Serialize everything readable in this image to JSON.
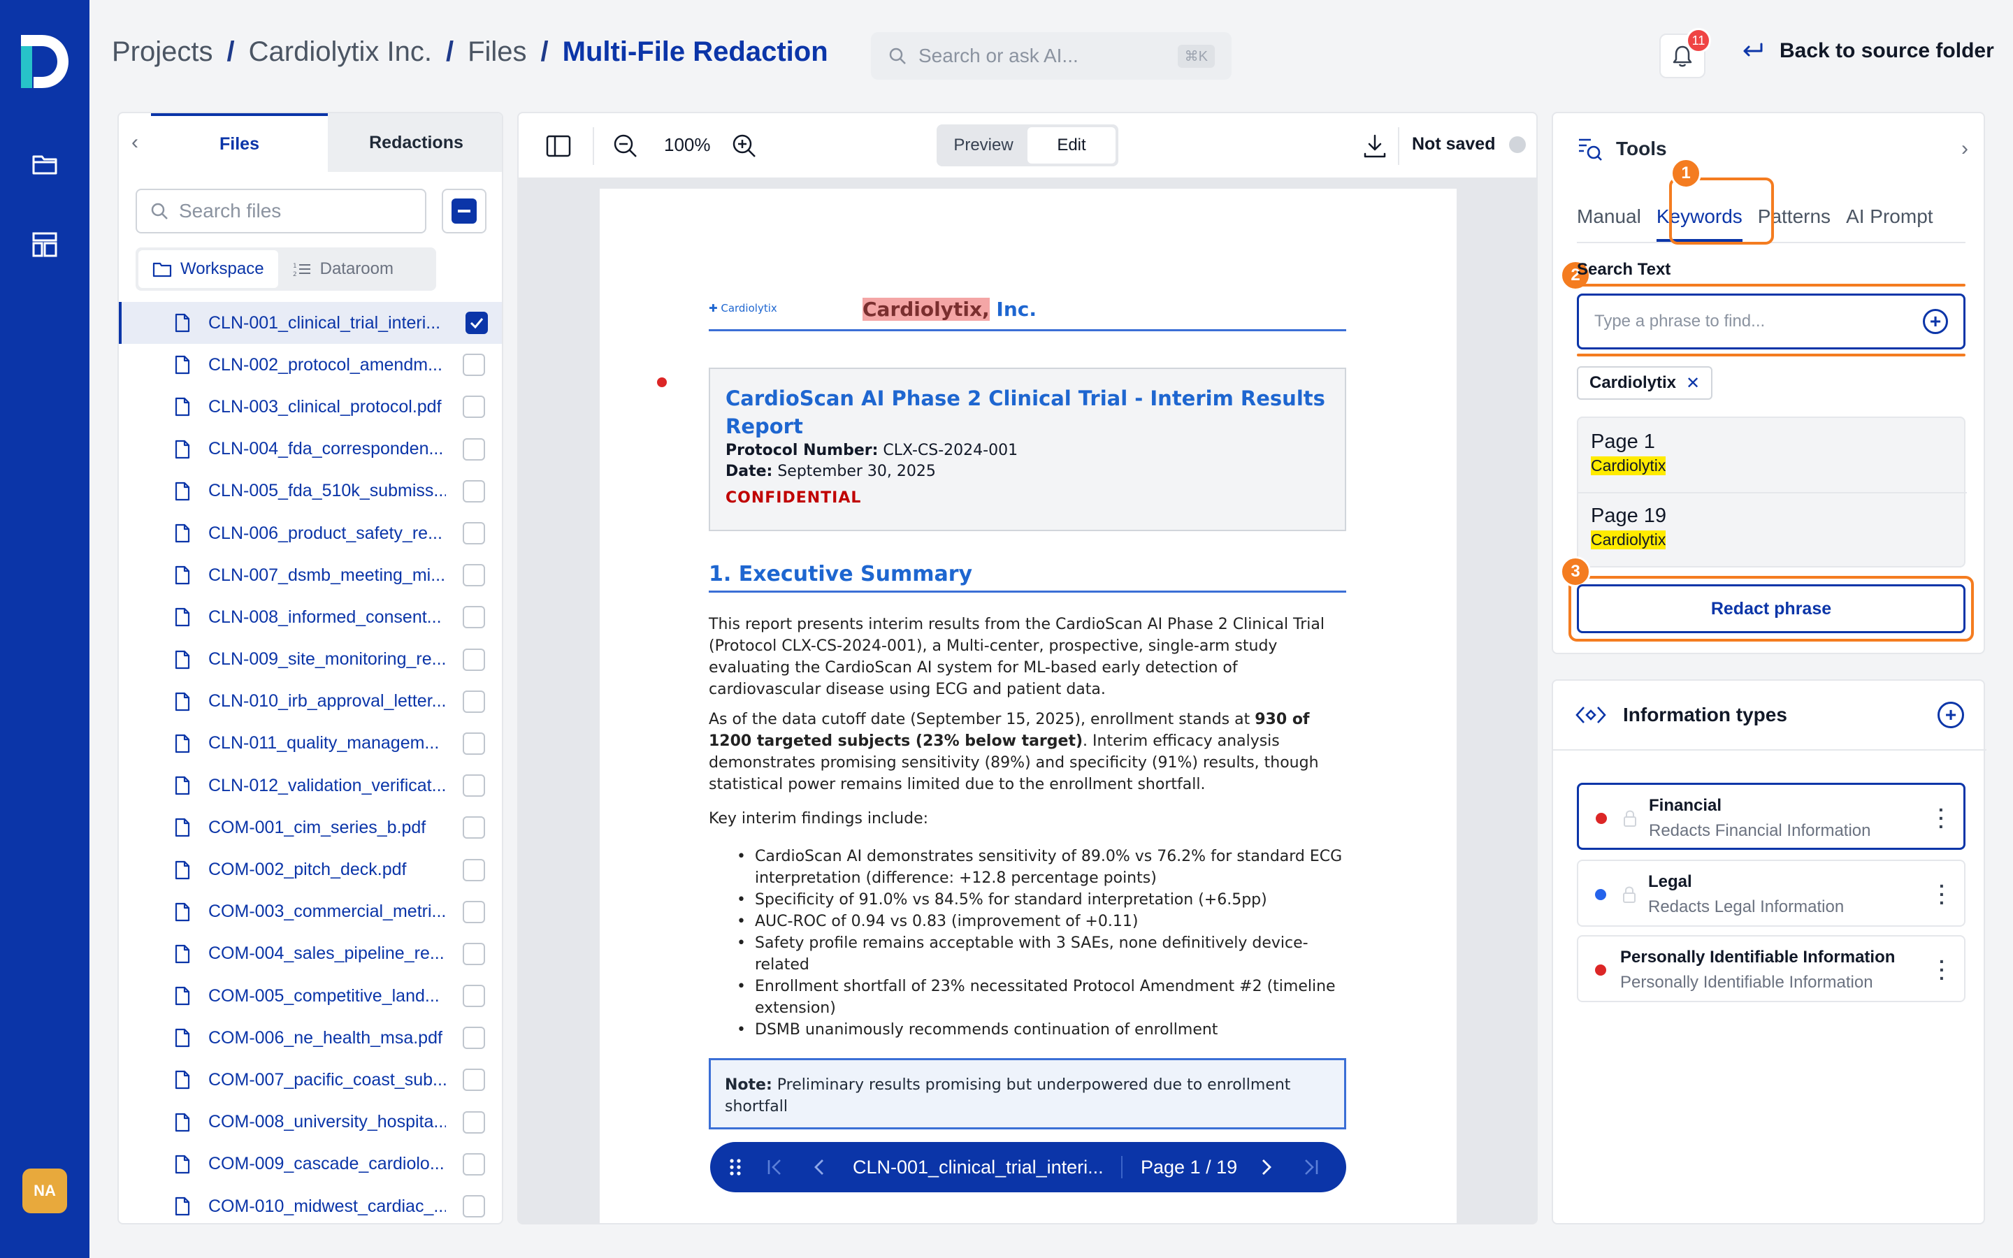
{
  "rail": {
    "avatar": "NA"
  },
  "breadcrumb": {
    "items": [
      "Projects",
      "Cardiolytix Inc.",
      "Files",
      "Multi-File Redaction"
    ],
    "sep": "/"
  },
  "search": {
    "placeholder": "Search or ask AI...",
    "shortcut": "⌘K"
  },
  "notifications": {
    "count": "11"
  },
  "back": {
    "label": "Back to source folder"
  },
  "files_panel": {
    "tabs": [
      "Files",
      "Redactions"
    ],
    "search_placeholder": "Search files",
    "segments": [
      "Workspace",
      "Dataroom"
    ],
    "files": [
      {
        "name": "CLN-001_clinical_trial_interi...",
        "checked": true
      },
      {
        "name": "CLN-002_protocol_amendm...",
        "checked": false
      },
      {
        "name": "CLN-003_clinical_protocol.pdf",
        "checked": false
      },
      {
        "name": "CLN-004_fda_corresponden...",
        "checked": false
      },
      {
        "name": "CLN-005_fda_510k_submiss...",
        "checked": false
      },
      {
        "name": "CLN-006_product_safety_re...",
        "checked": false
      },
      {
        "name": "CLN-007_dsmb_meeting_mi...",
        "checked": false
      },
      {
        "name": "CLN-008_informed_consent...",
        "checked": false
      },
      {
        "name": "CLN-009_site_monitoring_re...",
        "checked": false
      },
      {
        "name": "CLN-010_irb_approval_letter...",
        "checked": false
      },
      {
        "name": "CLN-011_quality_managem...",
        "checked": false
      },
      {
        "name": "CLN-012_validation_verificat...",
        "checked": false
      },
      {
        "name": "COM-001_cim_series_b.pdf",
        "checked": false
      },
      {
        "name": "COM-002_pitch_deck.pdf",
        "checked": false
      },
      {
        "name": "COM-003_commercial_metri...",
        "checked": false
      },
      {
        "name": "COM-004_sales_pipeline_re...",
        "checked": false
      },
      {
        "name": "COM-005_competitive_land...",
        "checked": false
      },
      {
        "name": "COM-006_ne_health_msa.pdf",
        "checked": false
      },
      {
        "name": "COM-007_pacific_coast_sub...",
        "checked": false
      },
      {
        "name": "COM-008_university_hospita...",
        "checked": false
      },
      {
        "name": "COM-009_cascade_cardiolo...",
        "checked": false
      },
      {
        "name": "COM-010_midwest_cardiac_...",
        "checked": false
      }
    ]
  },
  "viewer": {
    "zoom": "100%",
    "modes": [
      "Preview",
      "Edit"
    ],
    "active_mode": "Edit",
    "save_status": "Not saved",
    "pager": {
      "file": "CLN-001_clinical_trial_interi...",
      "page": "Page 1 / 19"
    }
  },
  "document": {
    "logo_text": "Cardiolytix",
    "company_highlight": "Cardiolytix,",
    "company_rest": " Inc.",
    "title": "CardioScan AI Phase 2 Clinical Trial - Interim Results Report",
    "protocol_label": "Protocol Number:",
    "protocol": " CLX-CS-2024-001",
    "date_label": "Date:",
    "date": " September 30, 2025",
    "confidential": "CONFIDENTIAL",
    "section": "1. Executive Summary",
    "para1": "This report presents interim results from the CardioScan AI Phase 2 Clinical Trial (Protocol CLX-CS-2024-001), a Multi-center, prospective, single-arm study evaluating the CardioScan AI system for ML-based early detection of cardiovascular disease using ECG and patient data.",
    "para2_a": "As of the data cutoff date (September 15, 2025), enrollment stands at ",
    "para2_b": "930 of 1200 targeted subjects (23% below target)",
    "para2_c": ". Interim efficacy analysis demonstrates promising sensitivity (89%) and specificity (91%) results, though statistical power remains limited due to the enrollment shortfall.",
    "para3": "Key interim findings include:",
    "bullets": [
      "CardioScan AI demonstrates sensitivity of 89.0% vs 76.2% for standard ECG interpretation (difference: +12.8 percentage points)",
      "Specificity of 91.0% vs 84.5% for standard interpretation (+6.5pp)",
      "AUC-ROC of 0.94 vs 0.83 (improvement of +0.11)",
      "Safety profile remains acceptable with 3 SAEs, none definitively device-related",
      "Enrollment shortfall of 23% necessitated Protocol Amendment #2 (timeline extension)",
      "DSMB unanimously recommends continuation of enrollment"
    ],
    "note_label": "Note:",
    "note": " Preliminary results promising but underpowered due to enrollment shortfall"
  },
  "tools": {
    "title": "Tools",
    "tabs": [
      "Manual",
      "Keywords",
      "Patterns",
      "AI Prompt"
    ],
    "search_label": "Search Text",
    "input_placeholder": "Type a phrase to find...",
    "chip": "Cardiolytix",
    "results": [
      {
        "page": "Page 1",
        "match": "Cardiolytix"
      },
      {
        "page": "Page 19",
        "match": "Cardiolytix"
      }
    ],
    "redact_button": "Redact phrase",
    "steps": [
      "1",
      "2",
      "3"
    ],
    "accent": "#f47c20"
  },
  "info_types": {
    "title": "Information types",
    "items": [
      {
        "name": "Financial",
        "desc": "Redacts Financial Information",
        "color": "#dc2626"
      },
      {
        "name": "Legal",
        "desc": "Redacts Legal Information",
        "color": "#2563eb"
      },
      {
        "name": "Personally Identifiable Information",
        "desc": "Personally Identifiable Information",
        "color": "#dc2626"
      }
    ]
  }
}
